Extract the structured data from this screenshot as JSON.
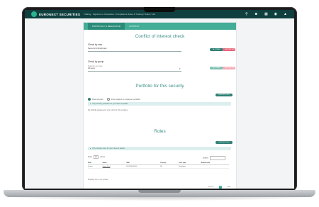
{
  "topbar": {
    "brand": "EURONEXT SECURITIES",
    "breadcrumb": "Trading · Signal to or Interaction / Compliance Rules & Trading / Rules / List",
    "icons": [
      "search-icon",
      "user-icon",
      "grid-icon",
      "eye-icon",
      "bell-icon"
    ]
  },
  "tabs": [
    "PORTFOLIO & BEHAVIOUR",
    "CONTACT"
  ],
  "conflict": {
    "title": "Conflict of interest check",
    "by_user_label": "Check by user",
    "user_value": "Name Emil (Employee)",
    "by_group_label": "Check by group",
    "group_placeholder": "Select an user type",
    "group_value": "All users",
    "allow": "ALLOWED",
    "disallow": "RESTRICTED"
  },
  "portfolio": {
    "title": "Portfolio for this security",
    "export": "EXPORT (CSV)",
    "radio_own": "Show all yours",
    "radio_related": "Show relations to employee's portfolios",
    "info": "Only showing portfolios for your Name & details",
    "empty": "No portfolio registered in your count for this company"
  },
  "roles": {
    "title": "Roles",
    "export": "EXPORT (CSV)",
    "info": "Only showing roles for your Name & details",
    "show_label": "Show",
    "show_value": "10",
    "entries": "entries",
    "search_label": "Search:",
    "columns": [
      "Role",
      "Name",
      "ISIN",
      "Country",
      "User type",
      "Related info"
    ],
    "rows": [
      [
        "Insider",
        "Name Emil",
        "DK0000000000",
        "DK",
        "Employee",
        ""
      ]
    ],
    "footer": "Showing 1 to 1 of 1 entries",
    "prev": "Previous",
    "page": "1",
    "next": "Next"
  }
}
